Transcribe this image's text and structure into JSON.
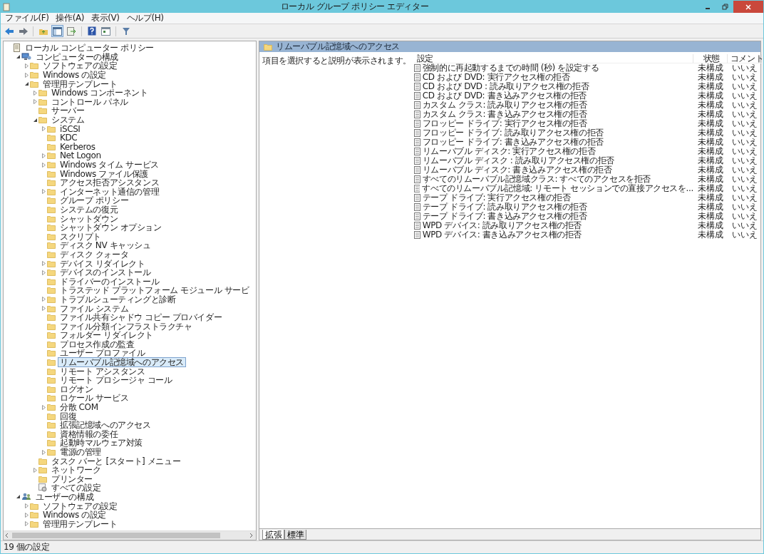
{
  "window": {
    "title": "ローカル グループ ポリシー エディター"
  },
  "menu": [
    "ファイル(F)",
    "操作(A)",
    "表示(V)",
    "ヘルプ(H)"
  ],
  "tree": [
    {
      "label": "ローカル コンピューター ポリシー",
      "kind": "policy",
      "selected": false,
      "children": [
        {
          "label": "コンピューターの構成",
          "kind": "computer",
          "expanded": true,
          "selected": false,
          "children": [
            {
              "label": "ソフトウェアの設定",
              "kind": "folder",
              "expanded": false,
              "selected": false
            },
            {
              "label": "Windows の設定",
              "kind": "folder",
              "expanded": false,
              "selected": false
            },
            {
              "label": "管理用テンプレート",
              "kind": "folder",
              "expanded": true,
              "selected": false,
              "children": [
                {
                  "label": "Windows コンポーネント",
                  "kind": "folder",
                  "expanded": false,
                  "selected": false
                },
                {
                  "label": "コントロール パネル",
                  "kind": "folder",
                  "expanded": false,
                  "selected": false
                },
                {
                  "label": "サーバー",
                  "kind": "folder",
                  "selected": false
                },
                {
                  "label": "システム",
                  "kind": "folder",
                  "expanded": true,
                  "selected": false,
                  "children": [
                    {
                      "label": "iSCSI",
                      "kind": "folder",
                      "expanded": false,
                      "selected": false
                    },
                    {
                      "label": "KDC",
                      "kind": "folder",
                      "selected": false
                    },
                    {
                      "label": "Kerberos",
                      "kind": "folder",
                      "selected": false
                    },
                    {
                      "label": "Net Logon",
                      "kind": "folder",
                      "expanded": false,
                      "selected": false
                    },
                    {
                      "label": "Windows タイム サービス",
                      "kind": "folder",
                      "expanded": false,
                      "selected": false
                    },
                    {
                      "label": "Windows ファイル保護",
                      "kind": "folder",
                      "selected": false
                    },
                    {
                      "label": "アクセス拒否アシスタンス",
                      "kind": "folder",
                      "selected": false
                    },
                    {
                      "label": "インターネット通信の管理",
                      "kind": "folder",
                      "expanded": false,
                      "selected": false
                    },
                    {
                      "label": "グループ ポリシー",
                      "kind": "folder",
                      "selected": false
                    },
                    {
                      "label": "システムの復元",
                      "kind": "folder",
                      "selected": false
                    },
                    {
                      "label": "シャットダウン",
                      "kind": "folder",
                      "selected": false
                    },
                    {
                      "label": "シャットダウン オプション",
                      "kind": "folder",
                      "selected": false
                    },
                    {
                      "label": "スクリプト",
                      "kind": "folder",
                      "selected": false
                    },
                    {
                      "label": "ディスク NV キャッシュ",
                      "kind": "folder",
                      "selected": false
                    },
                    {
                      "label": "ディスク クォータ",
                      "kind": "folder",
                      "selected": false
                    },
                    {
                      "label": "デバイス リダイレクト",
                      "kind": "folder",
                      "expanded": false,
                      "selected": false
                    },
                    {
                      "label": "デバイスのインストール",
                      "kind": "folder",
                      "expanded": false,
                      "selected": false
                    },
                    {
                      "label": "ドライバーのインストール",
                      "kind": "folder",
                      "selected": false
                    },
                    {
                      "label": "トラステッド プラットフォーム モジュール サービ",
                      "kind": "folder",
                      "selected": false
                    },
                    {
                      "label": "トラブルシューティングと診断",
                      "kind": "folder",
                      "expanded": false,
                      "selected": false
                    },
                    {
                      "label": "ファイル システム",
                      "kind": "folder",
                      "expanded": false,
                      "selected": false
                    },
                    {
                      "label": "ファイル共有シャドウ コピー プロバイダー",
                      "kind": "folder",
                      "selected": false
                    },
                    {
                      "label": "ファイル分類インフラストラクチャ",
                      "kind": "folder",
                      "selected": false
                    },
                    {
                      "label": "フォルダー リダイレクト",
                      "kind": "folder",
                      "selected": false
                    },
                    {
                      "label": "プロセス作成の監査",
                      "kind": "folder",
                      "selected": false
                    },
                    {
                      "label": "ユーザー プロファイル",
                      "kind": "folder",
                      "selected": false
                    },
                    {
                      "label": "リムーバブル記憶域へのアクセス",
                      "kind": "folder",
                      "selected": true
                    },
                    {
                      "label": "リモート アシスタンス",
                      "kind": "folder",
                      "selected": false
                    },
                    {
                      "label": "リモート プロシージャ コール",
                      "kind": "folder",
                      "selected": false
                    },
                    {
                      "label": "ログオン",
                      "kind": "folder",
                      "selected": false
                    },
                    {
                      "label": "ロケール サービス",
                      "kind": "folder",
                      "selected": false
                    },
                    {
                      "label": "分散 COM",
                      "kind": "folder",
                      "expanded": false,
                      "selected": false
                    },
                    {
                      "label": "回復",
                      "kind": "folder",
                      "selected": false
                    },
                    {
                      "label": "拡張記憶域へのアクセス",
                      "kind": "folder",
                      "selected": false
                    },
                    {
                      "label": "資格情報の委任",
                      "kind": "folder",
                      "selected": false
                    },
                    {
                      "label": "起動時マルウェア対策",
                      "kind": "folder",
                      "selected": false
                    },
                    {
                      "label": "電源の管理",
                      "kind": "folder",
                      "expanded": false,
                      "selected": false
                    }
                  ]
                },
                {
                  "label": "タスク バーと [スタート] メニュー",
                  "kind": "folder",
                  "selected": false
                },
                {
                  "label": "ネットワーク",
                  "kind": "folder",
                  "expanded": false,
                  "selected": false
                },
                {
                  "label": "プリンター",
                  "kind": "folder",
                  "selected": false
                },
                {
                  "label": "すべての設定",
                  "kind": "settings",
                  "selected": false
                }
              ]
            }
          ]
        },
        {
          "label": "ユーザーの構成",
          "kind": "user",
          "expanded": true,
          "selected": false,
          "children": [
            {
              "label": "ソフトウェアの設定",
              "kind": "folder",
              "expanded": false,
              "selected": false
            },
            {
              "label": "Windows の設定",
              "kind": "folder",
              "expanded": false,
              "selected": false
            },
            {
              "label": "管理用テンプレート",
              "kind": "folder",
              "expanded": false,
              "selected": false
            }
          ]
        }
      ]
    }
  ],
  "panel": {
    "title": "リムーバブル記憶域へのアクセス",
    "description": "項目を選択すると説明が表示されます。",
    "columns": [
      "設定",
      "状態",
      "コメント"
    ],
    "rows": [
      {
        "setting": "強制的に再起動するまでの時間 (秒) を設定する",
        "state": "未構成",
        "comment": "いいえ"
      },
      {
        "setting": "CD および DVD: 実行アクセス権の拒否",
        "state": "未構成",
        "comment": "いいえ"
      },
      {
        "setting": "CD および DVD : 読み取りアクセス権の拒否",
        "state": "未構成",
        "comment": "いいえ"
      },
      {
        "setting": "CD および DVD: 書き込みアクセス権の拒否",
        "state": "未構成",
        "comment": "いいえ"
      },
      {
        "setting": "カスタム クラス: 読み取りアクセス権の拒否",
        "state": "未構成",
        "comment": "いいえ"
      },
      {
        "setting": "カスタム クラス: 書き込みアクセス権の拒否",
        "state": "未構成",
        "comment": "いいえ"
      },
      {
        "setting": "フロッピー ドライブ: 実行アクセス権の拒否",
        "state": "未構成",
        "comment": "いいえ"
      },
      {
        "setting": "フロッピー ドライブ: 読み取りアクセス権の拒否",
        "state": "未構成",
        "comment": "いいえ"
      },
      {
        "setting": "フロッピー ドライブ: 書き込みアクセス権の拒否",
        "state": "未構成",
        "comment": "いいえ"
      },
      {
        "setting": "リムーバブル ディスク: 実行アクセス権の拒否",
        "state": "未構成",
        "comment": "いいえ"
      },
      {
        "setting": "リムーバブル ディスク : 読み取りアクセス権の拒否",
        "state": "未構成",
        "comment": "いいえ"
      },
      {
        "setting": "リムーバブル ディスク: 書き込みアクセス権の拒否",
        "state": "未構成",
        "comment": "いいえ"
      },
      {
        "setting": "すべてのリムーバブル記憶域クラス: すべてのアクセスを拒否",
        "state": "未構成",
        "comment": "いいえ"
      },
      {
        "setting": "すべてのリムーバブル記憶域: リモート セッションでの直接アクセスを...",
        "state": "未構成",
        "comment": "いいえ"
      },
      {
        "setting": "テープ ドライブ: 実行アクセス権の拒否",
        "state": "未構成",
        "comment": "いいえ"
      },
      {
        "setting": "テープ ドライブ: 読み取りアクセス権の拒否",
        "state": "未構成",
        "comment": "いいえ"
      },
      {
        "setting": "テープ ドライブ: 書き込みアクセス権の拒否",
        "state": "未構成",
        "comment": "いいえ"
      },
      {
        "setting": "WPD デバイス: 読み取りアクセス権の拒否",
        "state": "未構成",
        "comment": "いいえ"
      },
      {
        "setting": "WPD デバイス: 書き込みアクセス権の拒否",
        "state": "未構成",
        "comment": "いいえ"
      }
    ]
  },
  "tabs": [
    {
      "label": "拡張",
      "selected": true
    },
    {
      "label": "標準",
      "selected": false
    }
  ],
  "status_bar": "19 個の設定"
}
